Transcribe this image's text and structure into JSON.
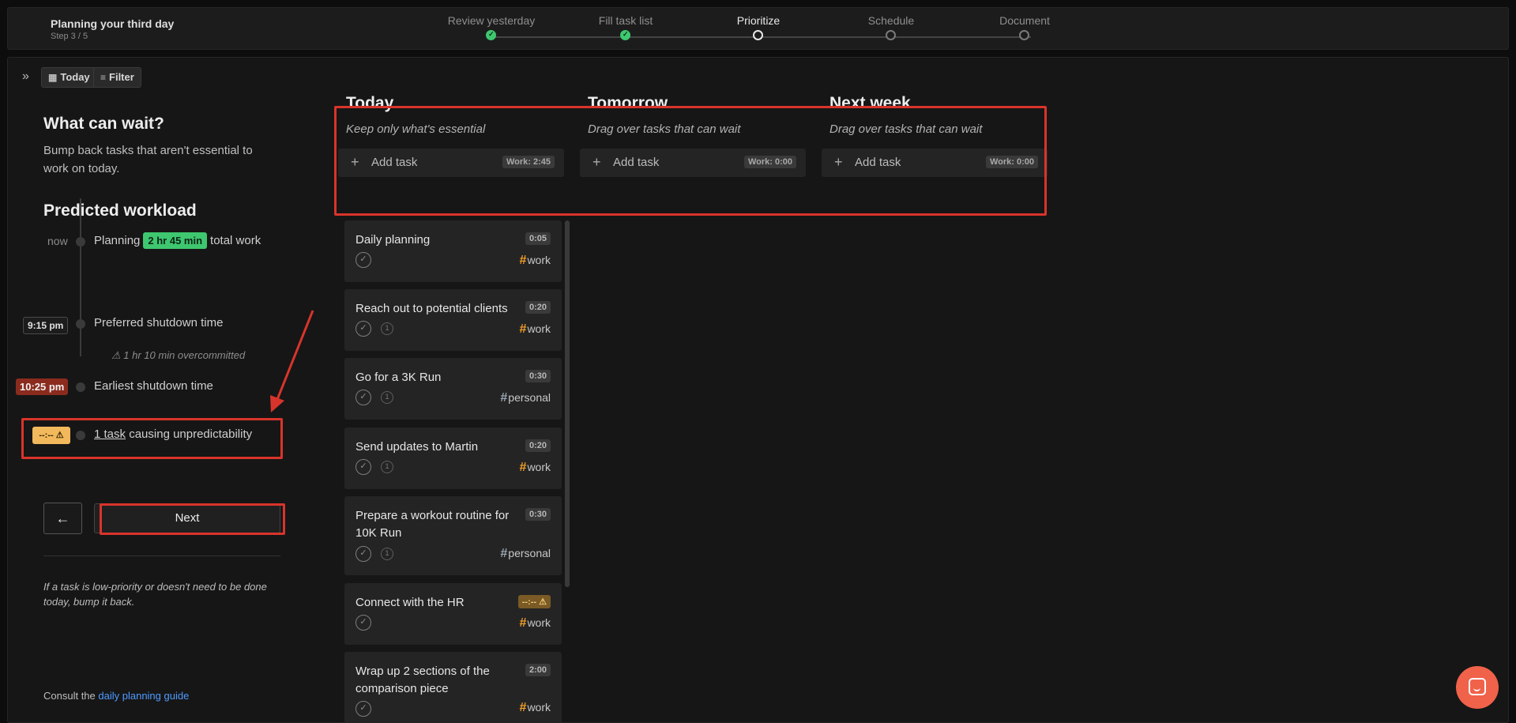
{
  "header": {
    "title": "Planning your third day",
    "step": "Step 3 / 5",
    "steps": [
      {
        "label": "Review yesterday",
        "state": "done"
      },
      {
        "label": "Fill task list",
        "state": "done"
      },
      {
        "label": "Prioritize",
        "state": "active"
      },
      {
        "label": "Schedule",
        "state": "pending"
      },
      {
        "label": "Document",
        "state": "pending"
      }
    ]
  },
  "toolbar": {
    "today_label": "Today",
    "filter_label": "Filter"
  },
  "left": {
    "wait_heading": "What can wait?",
    "wait_desc": "Bump back tasks that aren't essential to work on today.",
    "predicted_heading": "Predicted workload",
    "now_label": "now",
    "planning_prefix": "Planning",
    "planning_amount": "2 hr 45 min",
    "planning_suffix": "total work",
    "preferred_time": "9:15 pm",
    "preferred_label": "Preferred shutdown time",
    "overcommitted": "1 hr 10 min overcommitted",
    "earliest_time": "10:25 pm",
    "earliest_label": "Earliest shutdown time",
    "unpredictable_badge": "--:--",
    "unpredictable_link": "1 task",
    "unpredictable_suffix": "causing unpredictability",
    "back_label": "←",
    "next_label": "Next",
    "hint": "If a task is low-priority or doesn't need to be done today, bump it back.",
    "guide_prefix": "Consult the",
    "guide_link": "daily planning guide"
  },
  "columns": [
    {
      "title": "Today",
      "subtitle": "Keep only what's essential",
      "add_label": "Add task",
      "work": "Work: 2:45"
    },
    {
      "title": "Tomorrow",
      "subtitle": "Drag over tasks that can wait",
      "add_label": "Add task",
      "work": "Work: 0:00"
    },
    {
      "title": "Next week",
      "subtitle": "Drag over tasks that can wait",
      "add_label": "Add task",
      "work": "Work: 0:00"
    }
  ],
  "tasks": [
    {
      "title": "Daily planning",
      "duration": "0:05",
      "tag": "work",
      "recurring": false
    },
    {
      "title": "Reach out to potential clients",
      "duration": "0:20",
      "tag": "work",
      "recurring": true
    },
    {
      "title": "Go for a 3K Run",
      "duration": "0:30",
      "tag": "personal",
      "recurring": true
    },
    {
      "title": "Send updates to Martin",
      "duration": "0:20",
      "tag": "work",
      "recurring": true
    },
    {
      "title": "Prepare a workout routine for 10K Run",
      "duration": "0:30",
      "tag": "personal",
      "recurring": true
    },
    {
      "title": "Connect with the HR",
      "duration": "--:--",
      "tag": "work",
      "recurring": false
    },
    {
      "title": "Wrap up 2 sections of the comparison piece",
      "duration": "2:00",
      "tag": "work",
      "recurring": false
    }
  ],
  "colors": {
    "accent_green": "#3ec76f",
    "warn_orange": "#f1b95b",
    "alert_red": "#d9342b",
    "link_blue": "#4f9bff"
  }
}
